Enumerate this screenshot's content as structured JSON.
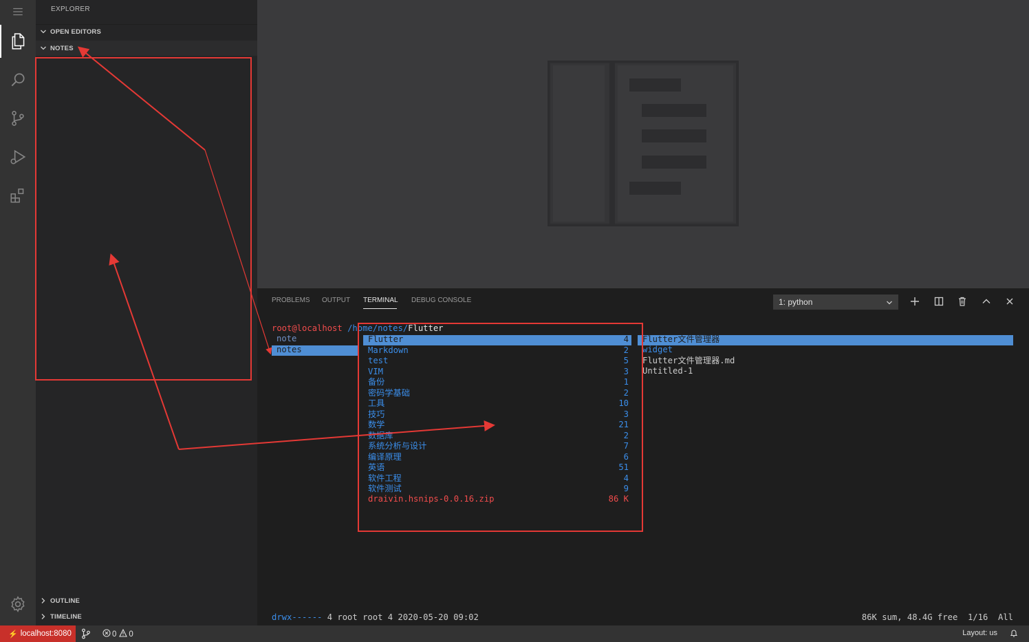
{
  "sidebar": {
    "title": "EXPLORER",
    "sections": {
      "open_editors": "OPEN EDITORS",
      "notes": "NOTES",
      "outline": "OUTLINE",
      "timeline": "TIMELINE"
    }
  },
  "panel": {
    "tabs": {
      "problems": "PROBLEMS",
      "output": "OUTPUT",
      "terminal": "TERMINAL",
      "debug_console": "DEBUG CONSOLE"
    },
    "terminal_select": "1: python"
  },
  "terminal": {
    "prompt_user": "root@localhost",
    "prompt_path": "/home/notes/",
    "prompt_dir": "Flutter",
    "left_col": [
      "note",
      "notes"
    ],
    "mid_col": [
      {
        "name": "Flutter",
        "count": "4"
      },
      {
        "name": "Markdown",
        "count": "2"
      },
      {
        "name": "test",
        "count": "5"
      },
      {
        "name": "VIM",
        "count": "3"
      },
      {
        "name": "备份",
        "count": "1"
      },
      {
        "name": "密码学基础",
        "count": "2"
      },
      {
        "name": "工具",
        "count": "10"
      },
      {
        "name": "技巧",
        "count": "3"
      },
      {
        "name": "数学",
        "count": "21"
      },
      {
        "name": "数据库",
        "count": "2"
      },
      {
        "name": "系统分析与设计",
        "count": "7"
      },
      {
        "name": "编译原理",
        "count": "6"
      },
      {
        "name": "英语",
        "count": "51"
      },
      {
        "name": "软件工程",
        "count": "4"
      },
      {
        "name": "软件测试",
        "count": "9"
      }
    ],
    "mid_file": {
      "name": "draivin.hsnips-0.0.16.zip",
      "size": "86 K"
    },
    "right_col": [
      "Flutter文件管理器",
      "widget",
      "Flutter文件管理器.md",
      "Untitled-1"
    ],
    "footer_perm": "drwx------",
    "footer_info": " 4 root root 4 2020-05-20 09:02",
    "footer_right": "86K sum, 48.4G free  1/16  All"
  },
  "status": {
    "remote": "localhost:8080",
    "errors": "0",
    "warnings": "0",
    "layout": "Layout: us"
  },
  "colors": {
    "annotation": "#e53935",
    "selection": "#4f8ed4",
    "remote_bg": "#c8302a"
  }
}
